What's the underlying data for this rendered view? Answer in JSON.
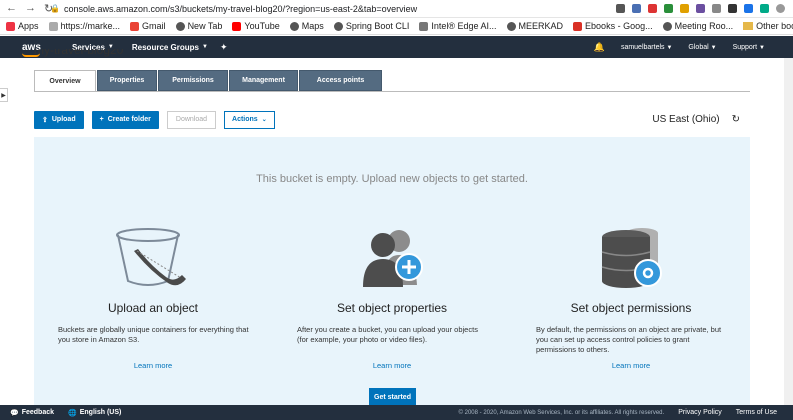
{
  "browser": {
    "url": "console.aws.amazon.com/s3/buckets/my-travel-blog20/?region=us-east-2&tab=overview",
    "bookmarks": [
      "Apps",
      "https://marke...",
      "Gmail",
      "New Tab",
      "YouTube",
      "Maps",
      "Spring Boot CLI",
      "Intel® Edge AI...",
      "MEERKAD",
      "Ebooks - Goog...",
      "Meeting Roo..."
    ],
    "other_bookmarks": "Other bookmarks"
  },
  "aws_nav": {
    "logo": "aws",
    "services": "Services",
    "resource_groups": "Resource Groups",
    "user": "samuelbartels",
    "region": "Global",
    "support": "Support"
  },
  "page": {
    "title_clipped": "my-travel-blog20",
    "tabs": [
      "Overview",
      "Properties",
      "Permissions",
      "Management",
      "Access points"
    ]
  },
  "toolbar": {
    "upload": "Upload",
    "create_folder": "Create folder",
    "download": "Download",
    "actions": "Actions",
    "region": "US East (Ohio)"
  },
  "panel": {
    "empty_message": "This bucket is empty. Upload new objects to get started.",
    "columns": [
      {
        "title": "Upload an object",
        "desc": "Buckets are globally unique containers for everything that you store in Amazon S3.",
        "link": "Learn more"
      },
      {
        "title": "Set object properties",
        "desc": "After you create a bucket, you can upload your objects (for example, your photo or video files).",
        "link": "Learn more"
      },
      {
        "title": "Set object permissions",
        "desc": "By default, the permissions on an object are private, but you can set up access control policies to grant permissions to others.",
        "link": "Learn more"
      }
    ],
    "get_started": "Get started"
  },
  "footer": {
    "feedback": "Feedback",
    "language": "English (US)",
    "copyright": "© 2008 - 2020, Amazon Web Services, Inc. or its affiliates. All rights reserved.",
    "privacy": "Privacy Policy",
    "terms": "Terms of Use"
  }
}
